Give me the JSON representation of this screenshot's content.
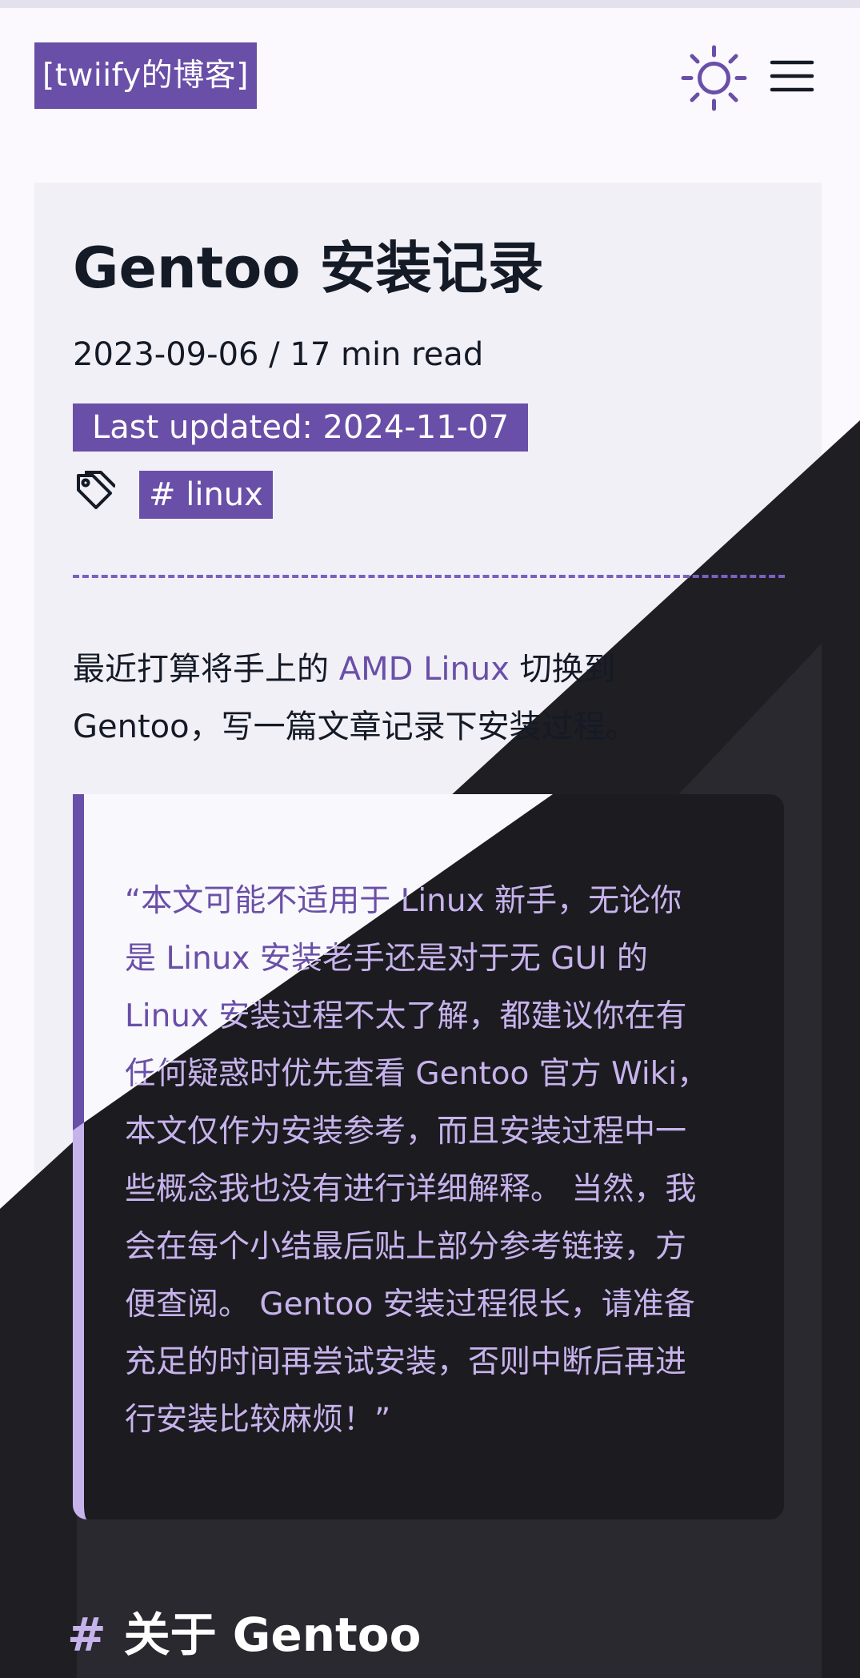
{
  "header": {
    "logo_text": "[twiify的博客]",
    "theme_toggle_icon": "sun-icon",
    "menu_icon": "hamburger-menu-icon"
  },
  "article": {
    "title": "Gentoo 安装记录",
    "meta": "2023-09-06 / 17 min read",
    "last_updated": "Last updated: 2024-11-07",
    "tag_icon": "tag-icon",
    "tag": "# linux",
    "intro_before": "最近打算将手上的 ",
    "intro_link": "AMD Linux",
    "intro_after": " 切换到\nGentoo，写一篇文章记录下安装过程。",
    "quote": "“本文可能不适用于 Linux 新手，无论你\n是 Linux 安装老手还是对于无 GUI 的\nLinux 安装过程不太了解，都建议你在有\n任何疑惑时优先查看 Gentoo 官方 Wiki，\n本文仅作为安装参考，而且安装过程中一\n些概念我也没有进行详细解释。 当然，我\n会在每个小结最后贴上部分参考链接，方\n便查阅。 Gentoo 安装过程很长，请准备\n充足的时间再尝试安装，否则中断后再进\n行安装比较麻烦！”",
    "section_heading_hash": "#",
    "section_heading": "关于 Gentoo"
  },
  "colors": {
    "accent": "#6a4fa8",
    "accent_light": "#c7b3ec",
    "light_bg": "#fbf9fd",
    "dark_bg": "#1f1e23",
    "text_dark": "#141a26"
  }
}
